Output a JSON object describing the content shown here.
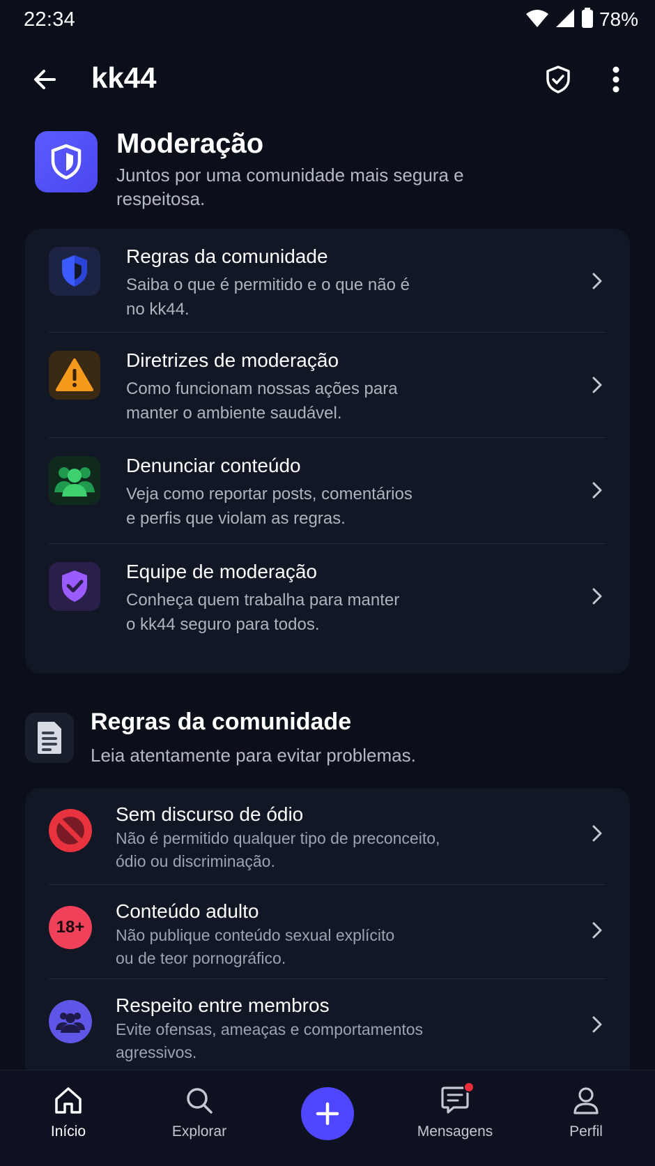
{
  "status_bar": {
    "time": "22:34",
    "battery_pct": "78%"
  },
  "app_bar": {
    "title": "kk44"
  },
  "moderation": {
    "title": "Moderação",
    "subtitle": "Juntos por uma comunidade mais segura e respeitosa."
  },
  "moderation_items": [
    {
      "title": "Regras da comunidade",
      "desc_line1": "Saiba o que é permitido e o que não é",
      "desc_line2": "no kk44.",
      "icon": "shield-icon"
    },
    {
      "title": "Diretrizes de moderação",
      "desc_line1": "Como funcionam nossas ações para",
      "desc_line2": "manter o ambiente saudável.",
      "icon": "warning-icon"
    },
    {
      "title": "Denunciar conteúdo",
      "desc_line1": "Veja como reportar posts, comentários",
      "desc_line2": "e perfis que violam as regras.",
      "icon": "users-icon"
    },
    {
      "title": "Equipe de moderação",
      "desc_line1": "Conheça quem trabalha para manter",
      "desc_line2": "o kk44 seguro para todos.",
      "icon": "shield-check-icon"
    }
  ],
  "rules_section": {
    "title": "Regras da comunidade",
    "subtitle": "Leia atentamente para evitar problemas."
  },
  "rules_items": [
    {
      "title": "Sem discurso de ódio",
      "desc_line1": "Não é permitido qualquer tipo de preconceito,",
      "desc_line2": "ódio ou discriminação.",
      "icon": "prohibited-icon"
    },
    {
      "title": "Conteúdo adulto",
      "desc_line1": "Não publique conteúdo sexual explícito",
      "desc_line2": "ou de teor pornográfico.",
      "icon": "18plus-icon",
      "icon_text": "18+"
    },
    {
      "title": "Respeito entre membros",
      "desc_line1": "Evite ofensas, ameaças e comportamentos",
      "desc_line2": "agressivos.",
      "icon": "group-icon"
    }
  ],
  "bottom_nav": {
    "home": "Início",
    "explore": "Explorar",
    "messages": "Mensagens",
    "profile": "Perfil"
  },
  "colors": {
    "background": "#0b0f19",
    "card": "#121725",
    "accent": "#4f46ff",
    "badge": "#ef2d3e"
  }
}
